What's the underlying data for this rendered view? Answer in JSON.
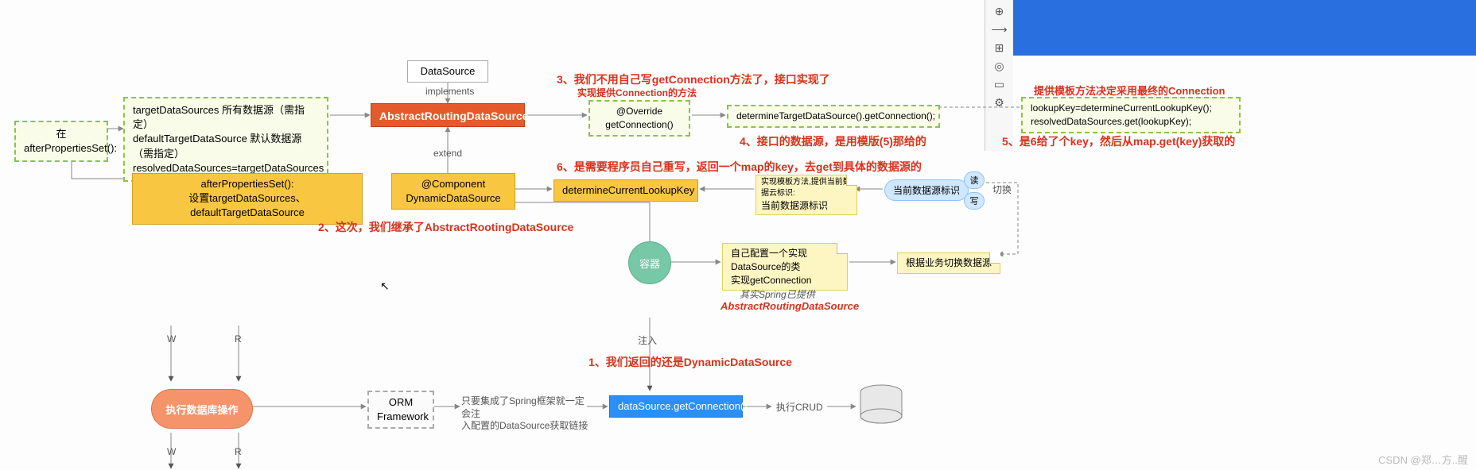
{
  "top": {
    "datasource": "DataSource",
    "implements": "implements",
    "extend": "extend"
  },
  "dashed_props": {
    "line1": "targetDataSources 所有数据源（需指定）",
    "line2": "defaultTargetDataSource   默认数据源（需指定）",
    "line3": "resolvedDataSources=targetDataSources"
  },
  "afterprops_label": "在afterPropertiesSet():",
  "orange_box": "AbstractRoutingDataSource",
  "override_box": {
    "l1": "@Override",
    "l2": "getConnection()"
  },
  "determine_conn": "determineTargetDataSource().getConnection();",
  "yellow_afterprops": {
    "l1": "afterPropertiesSet():",
    "l2": "设置targetDataSources、defaultTargetDataSource"
  },
  "component_box": {
    "l1": "@Component",
    "l2": "DynamicDataSource"
  },
  "lookupkey_box": "determineCurrentLookupKey",
  "lookup_note": {
    "l1": "实现模板方法,提供当前数据云标识:",
    "l2": "当前数据源标识"
  },
  "read_write": {
    "r": "读",
    "w": "写"
  },
  "badge_current": "当前数据源标识",
  "badge_switch": "切换",
  "container": "容器",
  "self_config": {
    "l1": "自己配置一个实现",
    "l2": "DataSource的类",
    "l3": "实现getConnection"
  },
  "switch_ds": "根据业务切换数据源",
  "spring_note": {
    "l1": "其实Spring已提供",
    "l2": "AbstractRoutingDataSource"
  },
  "inject": "注入",
  "orm": {
    "l1": "ORM",
    "l2": "Framework"
  },
  "orm_note": {
    "l1": "只要集成了Spring框架就一定会注",
    "l2": "入配置的DataSource获取链接"
  },
  "getconn_box": "dataSource.getConnection();",
  "exec_crud": "执行CRUD",
  "pill_title": "执行数据库操作",
  "wr": {
    "w": "W",
    "r": "R"
  },
  "red": {
    "n1": "1、我们返回的还是DynamicDataSource",
    "n2": "2、这次，我们继承了AbstractRootingDataSource",
    "n3a": "3、我们不用自己写getConnection方法了，接口实现了",
    "n3b": "实现提供Connection的方法",
    "n4": "4、接口的数据源，是用模版(5)那给的",
    "n5": "5、是6给了个key，然后从map.get(key)获取的",
    "n6": "6、是需要程序员自己重写，返回一个map的key，去get到具体的数据源的"
  },
  "right_note": {
    "title": "提供模板方法决定采用最终的Connection",
    "l1": "lookupKey=determineCurrentLookupKey();",
    "l2": "resolvedDataSources.get(lookupKey);"
  },
  "watermark": "CSDN @郑…方..醒"
}
